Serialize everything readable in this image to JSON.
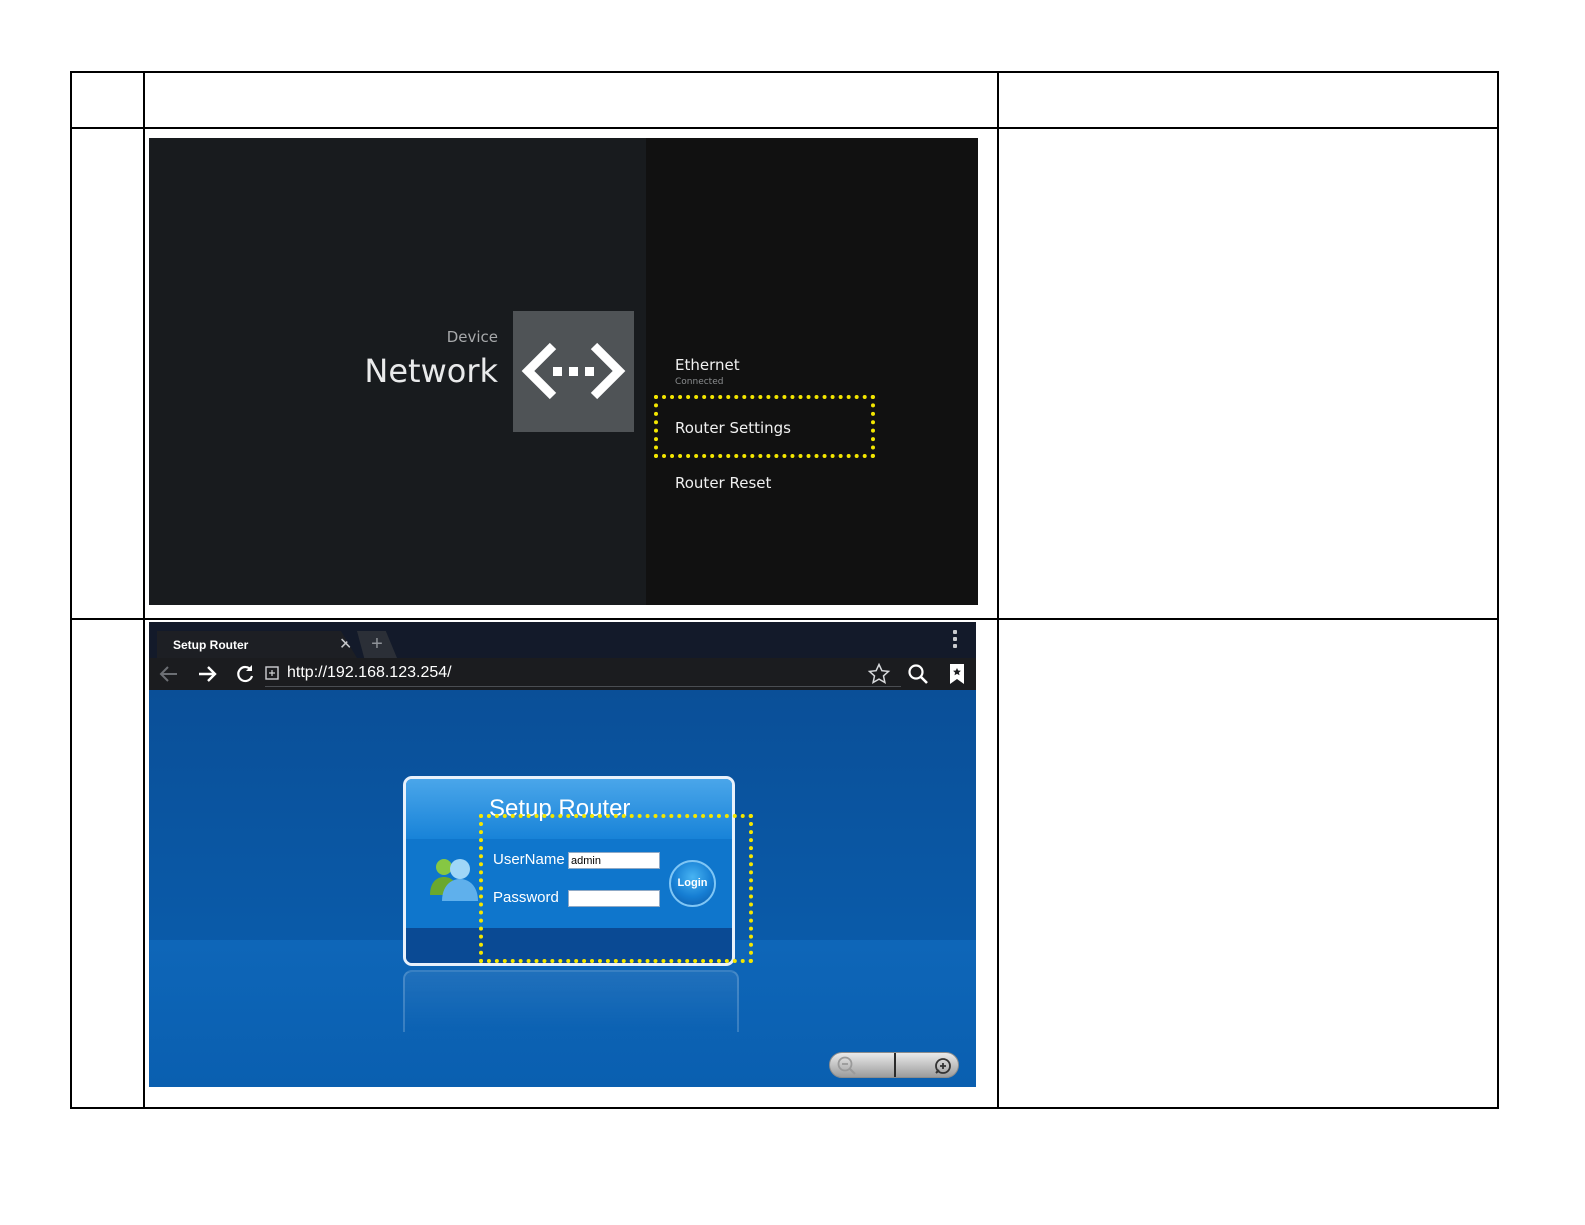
{
  "table": {
    "header_cells": [
      "",
      "",
      ""
    ],
    "row1_label": "",
    "row1_notes": "",
    "row2_label": "",
    "row2_notes": ""
  },
  "tv_screen": {
    "breadcrumb": "Device",
    "title": "Network",
    "icon": "network-arrows-icon",
    "items": [
      {
        "label": "Ethernet",
        "sublabel": "Connected"
      },
      {
        "label": "Router Settings"
      },
      {
        "label": "Router Reset"
      }
    ],
    "highlight_color": "#f3e600"
  },
  "browser": {
    "tab_title": "Setup Router",
    "url": "http://192.168.123.254/",
    "login": {
      "title": "Setup Router",
      "username_label": "UserName",
      "username_value": "admin",
      "password_label": "Password",
      "password_value": "",
      "login_button": "Login"
    },
    "icons": [
      "back-arrow-icon",
      "forward-arrow-icon",
      "reload-icon",
      "site-info-icon",
      "star-icon",
      "search-icon",
      "bookmarks-icon",
      "zoom-out-icon",
      "zoom-in-icon"
    ]
  }
}
